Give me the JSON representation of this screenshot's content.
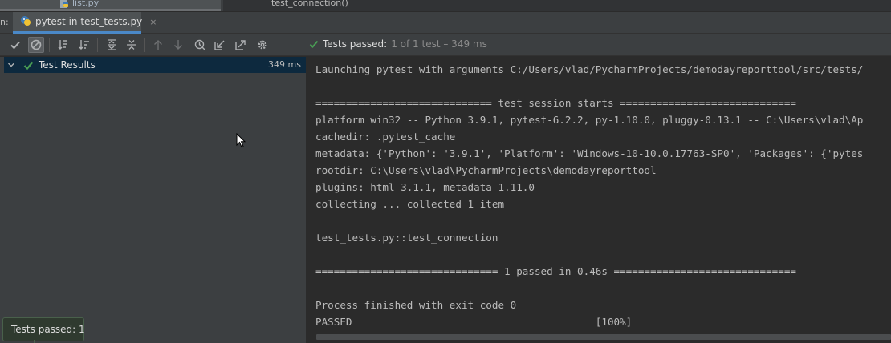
{
  "editor": {
    "file_tab": "list.py",
    "breadcrumb": "test_connection()"
  },
  "run_panel": {
    "prefix": "n:",
    "tab_label": "pytest in test_tests.py",
    "tab_close": "×"
  },
  "toolbar": {
    "status_passed": "Tests passed:",
    "status_detail": "1 of 1 test – 349 ms",
    "icons": [
      "check-icon",
      "stop-circle-icon",
      "sort-alpha-icon",
      "sort-duration-icon",
      "expand-all-icon",
      "collapse-all-icon",
      "arrow-up-icon",
      "arrow-down-icon",
      "history-icon",
      "import-icon",
      "export-icon",
      "gear-icon"
    ]
  },
  "tree": {
    "root_label": "Test Results",
    "root_duration": "349 ms"
  },
  "console": {
    "lines": [
      "Launching pytest with arguments C:/Users/vlad/PycharmProjects/demodayreporttool/src/tests/",
      "",
      "============================= test session starts =============================",
      "platform win32 -- Python 3.9.1, pytest-6.2.2, py-1.10.0, pluggy-0.13.1 -- C:\\Users\\vlad\\Ap",
      "cachedir: .pytest_cache",
      "metadata: {'Python': '3.9.1', 'Platform': 'Windows-10-10.0.17763-SP0', 'Packages': {'pytes",
      "rootdir: C:\\Users\\vlad\\PycharmProjects\\demodayreporttool",
      "plugins: html-3.1.1, metadata-1.11.0",
      "collecting ... collected 1 item",
      "",
      "test_tests.py::test_connection",
      "",
      "============================== 1 passed in 0.46s ==============================",
      "",
      "Process finished with exit code 0",
      "PASSED                                        [100%]"
    ]
  },
  "notification": {
    "text": "Tests passed: 1"
  },
  "colors": {
    "accent_green": "#499c54",
    "selection": "#0d293e",
    "tab_underline": "#4a88c7"
  }
}
